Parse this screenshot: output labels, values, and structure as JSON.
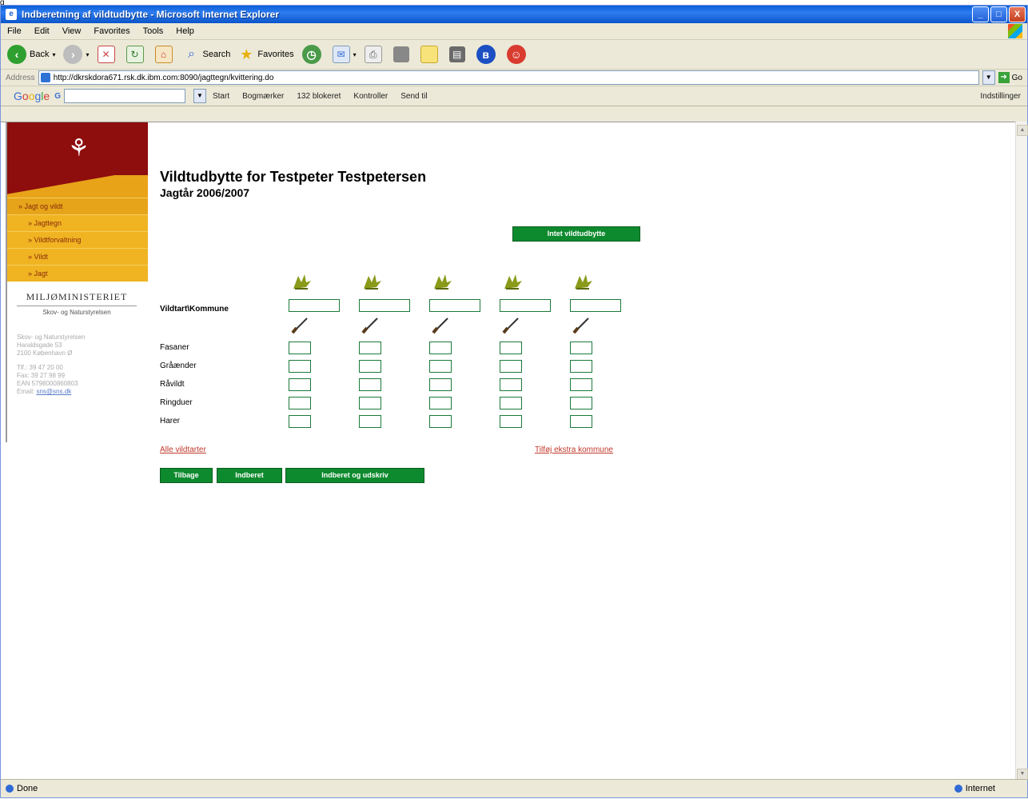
{
  "top_glyph": "g",
  "window": {
    "title": "Indberetning af vildtudbytte - Microsoft Internet Explorer",
    "buttons": {
      "minimize": "_",
      "maximize": "□",
      "close": "X"
    }
  },
  "menu": [
    "File",
    "Edit",
    "View",
    "Favorites",
    "Tools",
    "Help"
  ],
  "toolbar": {
    "back": "Back",
    "search": "Search",
    "favorites": "Favorites"
  },
  "address": {
    "label": "Address",
    "url": "http://dkrskdora671.rsk.dk.ibm.com:8090/jagttegn/kvittering.do",
    "go": "Go"
  },
  "googlebar": {
    "logo": [
      "G",
      "o",
      "o",
      "g",
      "l",
      "e"
    ],
    "g_button": "G",
    "items": [
      "Start",
      "Bogmærker",
      "132 blokeret",
      "Kontroller",
      "Send til"
    ],
    "settings": "Indstillinger"
  },
  "sidebar": {
    "nav": [
      {
        "label": "» Jagt og vildt",
        "level": 1
      },
      {
        "label": "» Jagttegn",
        "level": 2
      },
      {
        "label": "» Vildtforvaltning",
        "level": 2
      },
      {
        "label": "» Vildt",
        "level": 2
      },
      {
        "label": "» Jagt",
        "level": 2
      }
    ],
    "ministry": "MILJØMINISTERIET",
    "agency": "Skov- og Naturstyrelsen",
    "address_lines": [
      "Skov- og Naturstyrelsen",
      "Haraldsgade 53",
      "2100 København Ø"
    ],
    "contact_lines": [
      "Tlf.: 39 47 20 00",
      "Fax: 39 27 98 99",
      "EAN 5798000860803"
    ],
    "email_label": "Email:",
    "email": "sns@sns.dk"
  },
  "content": {
    "title": "Vildtudbytte for Testpeter Testpetersen",
    "subtitle": "Jagtår 2006/2007",
    "no_catch_button": "Intet vildtudbytte",
    "species_header": "Vildtart\\Kommune",
    "species": [
      "Fasaner",
      "Gråænder",
      "Råvildt",
      "Ringduer",
      "Harer"
    ],
    "kommune_fields": [
      "",
      "",
      "",
      "",
      ""
    ],
    "all_species_link": "Alle vildtarter",
    "add_kommune_link": "Tilføj ekstra kommune",
    "buttons": [
      "Tilbage",
      "Indberet",
      "Indberet og udskriv"
    ]
  },
  "status": {
    "left": "Done",
    "zone": "Internet"
  },
  "colors": {
    "title_blue": "#0a5fd8",
    "banner_red": "#8e0d0d",
    "nav_gold": "#f0b423",
    "button_green": "#0e8a2e",
    "link_red": "#c0392b"
  }
}
